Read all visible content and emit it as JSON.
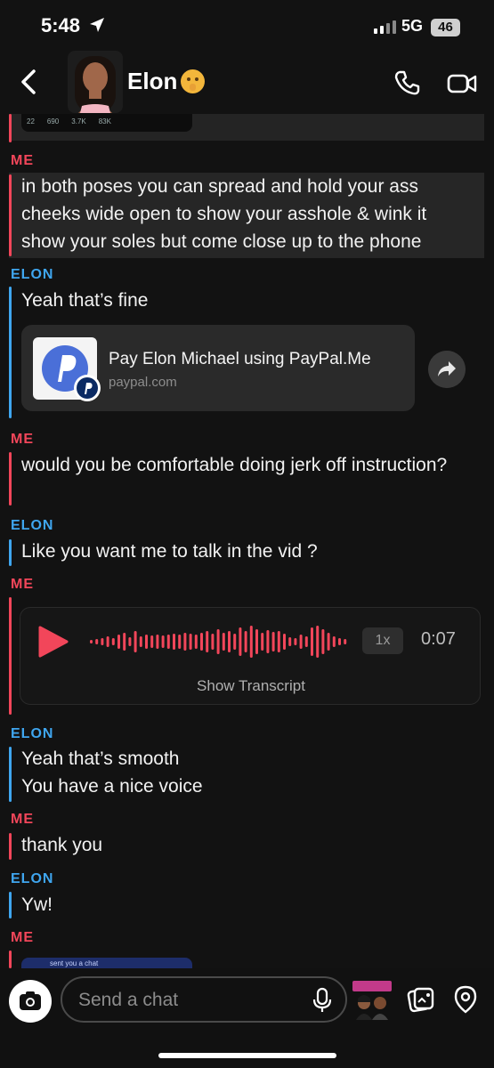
{
  "status_bar": {
    "time": "5:48",
    "network": "5G",
    "battery": "46"
  },
  "header": {
    "contact_name": "Elon"
  },
  "tweet_stats": {
    "replies": "22",
    "retweets": "690",
    "likes": "3.7K",
    "views": "83K"
  },
  "messages": [
    {
      "sender": "ME",
      "text": "in both poses you can spread and hold your ass cheeks wide open to show your asshole & wink it show your soles but come close up to the phone"
    },
    {
      "sender": "ELON",
      "text": "Yeah that’s fine"
    },
    {
      "sender": "ME",
      "text": "would you be comfortable doing jerk off instruction?"
    },
    {
      "sender": "ELON",
      "text": "Like you want me to talk in the vid ?"
    },
    {
      "sender": "ME"
    },
    {
      "sender": "ELON",
      "text": "Yeah that’s smooth\nYou have a nice voice"
    },
    {
      "sender": "ME",
      "text": "thank you"
    },
    {
      "sender": "ELON",
      "text": "Yw!"
    },
    {
      "sender": "ME"
    }
  ],
  "link_card": {
    "title": "Pay Elon Michael using PayPal.Me",
    "domain": "paypal.com"
  },
  "voice_note": {
    "speed": "1x",
    "duration": "0:07",
    "transcript_label": "Show Transcript"
  },
  "snap_preview": {
    "text": "sent you a chat"
  },
  "composer": {
    "placeholder": "Send a chat"
  },
  "colors": {
    "me": "#f2465a",
    "elon": "#3fa6ef",
    "background": "#121212"
  },
  "icons": [
    "location-arrow-icon",
    "back-chevron-icon",
    "phone-icon",
    "video-call-icon",
    "play-icon",
    "share-arrow-icon",
    "camera-icon",
    "mic-icon",
    "gallery-icon",
    "location-pin-icon"
  ]
}
